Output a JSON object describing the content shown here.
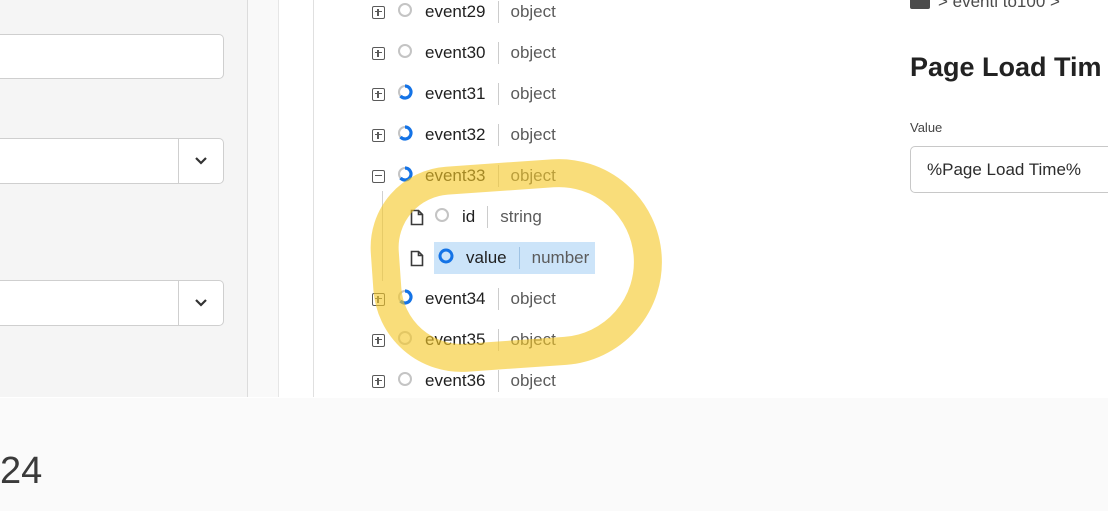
{
  "tree": {
    "rows": [
      {
        "name": "event29",
        "type": "object",
        "status": "empty",
        "expand": "plus"
      },
      {
        "name": "event30",
        "type": "object",
        "status": "empty",
        "expand": "plus"
      },
      {
        "name": "event31",
        "type": "object",
        "status": "partial",
        "expand": "plus"
      },
      {
        "name": "event32",
        "type": "object",
        "status": "partial",
        "expand": "plus"
      },
      {
        "name": "event33",
        "type": "object",
        "status": "partial",
        "expand": "minus"
      },
      {
        "name": "id",
        "type": "string",
        "status": "empty",
        "leaf": true
      },
      {
        "name": "value",
        "type": "number",
        "status": "full",
        "leaf": true,
        "selected": true
      },
      {
        "name": "event34",
        "type": "object",
        "status": "partial",
        "expand": "plus"
      },
      {
        "name": "event35",
        "type": "object",
        "status": "empty",
        "expand": "plus"
      },
      {
        "name": "event36",
        "type": "object",
        "status": "empty",
        "expand": "plus"
      }
    ]
  },
  "details": {
    "breadcrumb": "> eventl to100 >",
    "title": "Page Load Tim",
    "value_label": "Value",
    "value": "%Page Load Time%"
  },
  "footer": {
    "counter": "24"
  },
  "colors": {
    "accent": "#1473e6",
    "highlight": "#f5c828",
    "selected_bg": "#cce4f9"
  }
}
